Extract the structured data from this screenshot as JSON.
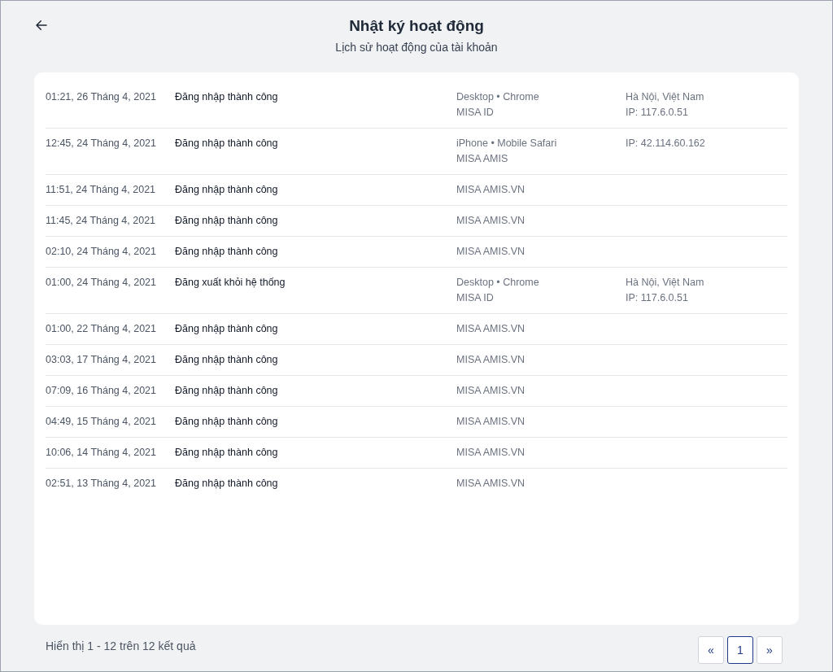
{
  "header": {
    "title": "Nhật ký hoạt động",
    "subtitle": "Lịch sử hoạt động của tài khoản"
  },
  "rows": [
    {
      "time": "01:21, 26 Tháng 4, 2021",
      "event": "Đăng nhập thành công",
      "device": [
        "Desktop • Chrome",
        "MISA ID"
      ],
      "location": [
        "Hà Nội, Việt Nam",
        "IP: 117.6.0.51"
      ]
    },
    {
      "time": "12:45, 24 Tháng 4, 2021",
      "event": "Đăng nhập thành công",
      "device": [
        "iPhone • Mobile Safari",
        "MISA AMIS"
      ],
      "location": [
        "IP: 42.114.60.162"
      ]
    },
    {
      "time": "11:51, 24 Tháng 4, 2021",
      "event": "Đăng nhập thành công",
      "device": [
        "MISA AMIS.VN"
      ],
      "location": []
    },
    {
      "time": "11:45, 24 Tháng 4, 2021",
      "event": "Đăng nhập thành công",
      "device": [
        "MISA AMIS.VN"
      ],
      "location": []
    },
    {
      "time": "02:10, 24 Tháng 4, 2021",
      "event": "Đăng nhập thành công",
      "device": [
        "MISA AMIS.VN"
      ],
      "location": []
    },
    {
      "time": "01:00, 24 Tháng 4, 2021",
      "event": "Đăng xuất khỏi hệ thống",
      "device": [
        "Desktop • Chrome",
        "MISA ID"
      ],
      "location": [
        "Hà Nội, Việt Nam",
        "IP: 117.6.0.51"
      ]
    },
    {
      "time": "01:00, 22 Tháng 4, 2021",
      "event": "Đăng nhập thành công",
      "device": [
        "MISA AMIS.VN"
      ],
      "location": []
    },
    {
      "time": "03:03, 17 Tháng 4, 2021",
      "event": "Đăng nhập thành công",
      "device": [
        "MISA AMIS.VN"
      ],
      "location": []
    },
    {
      "time": "07:09, 16 Tháng 4, 2021",
      "event": "Đăng nhập thành công",
      "device": [
        "MISA AMIS.VN"
      ],
      "location": []
    },
    {
      "time": "04:49, 15 Tháng 4, 2021",
      "event": "Đăng nhập thành công",
      "device": [
        "MISA AMIS.VN"
      ],
      "location": []
    },
    {
      "time": "10:06, 14 Tháng 4, 2021",
      "event": "Đăng nhập thành công",
      "device": [
        "MISA AMIS.VN"
      ],
      "location": []
    },
    {
      "time": "02:51, 13 Tháng 4, 2021",
      "event": "Đăng nhập thành công",
      "device": [
        "MISA AMIS.VN"
      ],
      "location": []
    }
  ],
  "footer": {
    "summary": "Hiển thị 1 - 12 trên 12 kết quả",
    "pages": [
      {
        "label": "«",
        "selected": false
      },
      {
        "label": "1",
        "selected": true
      },
      {
        "label": "»",
        "selected": false
      }
    ]
  }
}
